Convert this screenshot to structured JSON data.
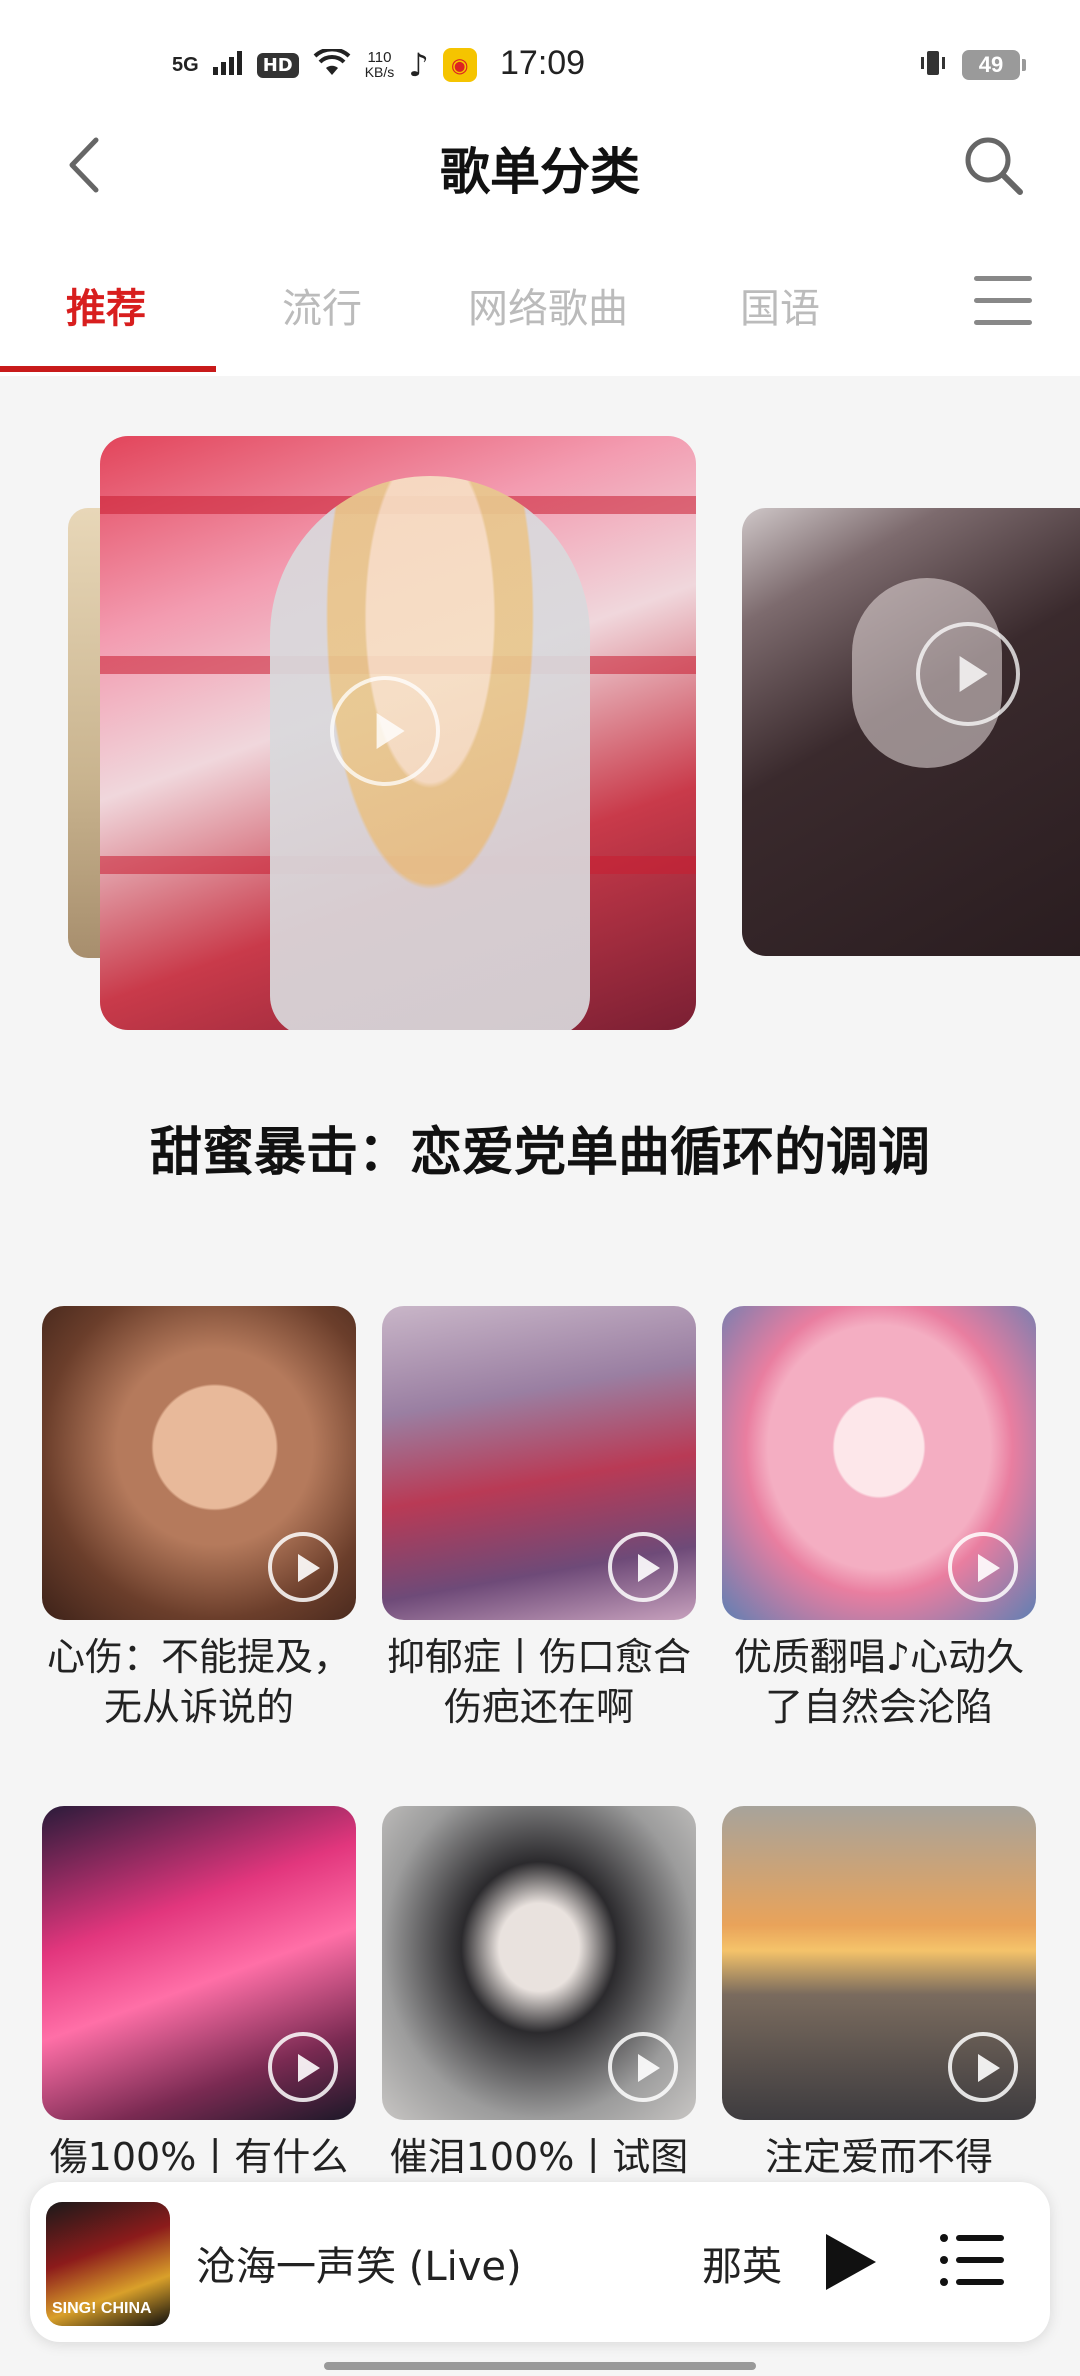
{
  "status_bar": {
    "network": "5G",
    "hd": "HD",
    "speed_value": "110",
    "speed_unit": "KB/s",
    "time": "17:09",
    "battery": "49"
  },
  "header": {
    "title": "歌单分类"
  },
  "tabs": [
    {
      "label": "推荐",
      "active": true
    },
    {
      "label": "流行",
      "active": false
    },
    {
      "label": "网络歌曲",
      "active": false
    },
    {
      "label": "国语",
      "active": false
    }
  ],
  "featured": {
    "title": "甜蜜暴击：恋爱党单曲循环的调调"
  },
  "playlists": [
    {
      "label": "心伤：不能提及，无从诉说的"
    },
    {
      "label": "抑郁症丨伤口愈合伤疤还在啊"
    },
    {
      "label": "优质翻唱♪心动久了自然会沦陷"
    },
    {
      "label": "傷100%丨有什么"
    },
    {
      "label": "催泪100%丨试图"
    },
    {
      "label": "注定爱而不得"
    }
  ],
  "mini_player": {
    "title": "沧海一声笑 (Live)",
    "artist": "那英",
    "cover_text": "SING! CHINA"
  },
  "icons": {
    "back": "chevron-left-icon",
    "search": "search-icon",
    "menu": "menu-icon",
    "play": "play-icon",
    "playlist": "playlist-icon"
  },
  "colors": {
    "accent": "#d81e1e",
    "inactive_tab": "#bbbbbb",
    "background": "#f5f5f5"
  }
}
